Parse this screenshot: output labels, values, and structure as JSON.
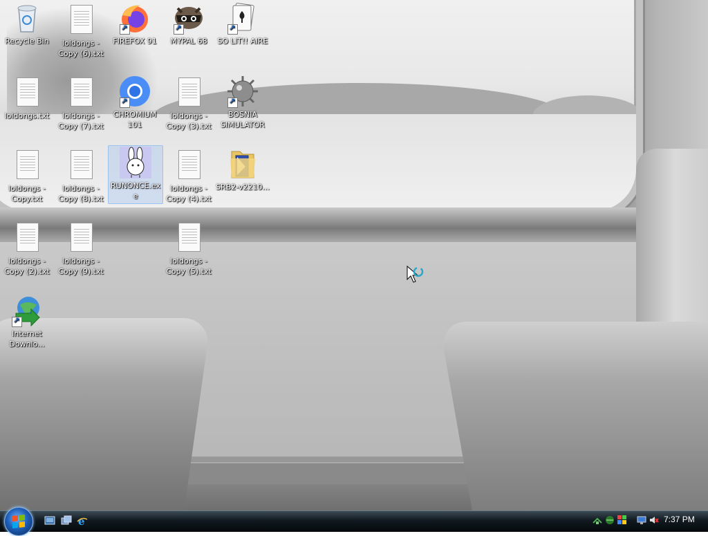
{
  "desktop": {
    "icons": [
      {
        "label": "Recycle Bin",
        "icon": "recycle-bin-icon"
      },
      {
        "label": "loldongs - Copy (6).txt",
        "icon": "text-file-icon"
      },
      {
        "label": "FIREFOX 91",
        "icon": "firefox-icon"
      },
      {
        "label": "MYPAL 68",
        "icon": "mypal-icon"
      },
      {
        "label": "SO LIT!! AIRE",
        "icon": "solitaire-icon"
      },
      {
        "label": "loldongs.txt",
        "icon": "text-file-icon"
      },
      {
        "label": "loldongs - Copy (7).txt",
        "icon": "text-file-icon"
      },
      {
        "label": "CHROMIUM 101",
        "icon": "chromium-icon"
      },
      {
        "label": "loldongs - Copy (3).txt",
        "icon": "text-file-icon"
      },
      {
        "label": "BOSNIA SIMULATOR",
        "icon": "mine-icon"
      },
      {
        "label": "loldongs - Copy.txt",
        "icon": "text-file-icon"
      },
      {
        "label": "loldongs - Copy (8).txt",
        "icon": "text-file-icon"
      },
      {
        "label": "RUNONCE.exe",
        "icon": "bunny-icon"
      },
      {
        "label": "loldongs - Copy (4).txt",
        "icon": "text-file-icon"
      },
      {
        "label": "SRB2-v2210...",
        "icon": "folder-icon"
      },
      {
        "label": "loldongs - Copy (2).txt",
        "icon": "text-file-icon"
      },
      {
        "label": "loldongs - Copy (9).txt",
        "icon": "text-file-icon"
      },
      {
        "label": "loldongs - Copy (5).txt",
        "icon": "text-file-icon"
      },
      {
        "label": "Internet Downlo...",
        "icon": "internet-download-manager-icon"
      }
    ]
  },
  "taskbar": {
    "start_icon": "windows-start-orb",
    "quick_launch": [
      "show-desktop-icon",
      "switch-windows-icon",
      "internet-explorer-icon"
    ],
    "tray": [
      "network-icon",
      "network-icon",
      "security-icon",
      "display-icon",
      "volume-muted-icon"
    ],
    "clock": "7:37 PM"
  }
}
